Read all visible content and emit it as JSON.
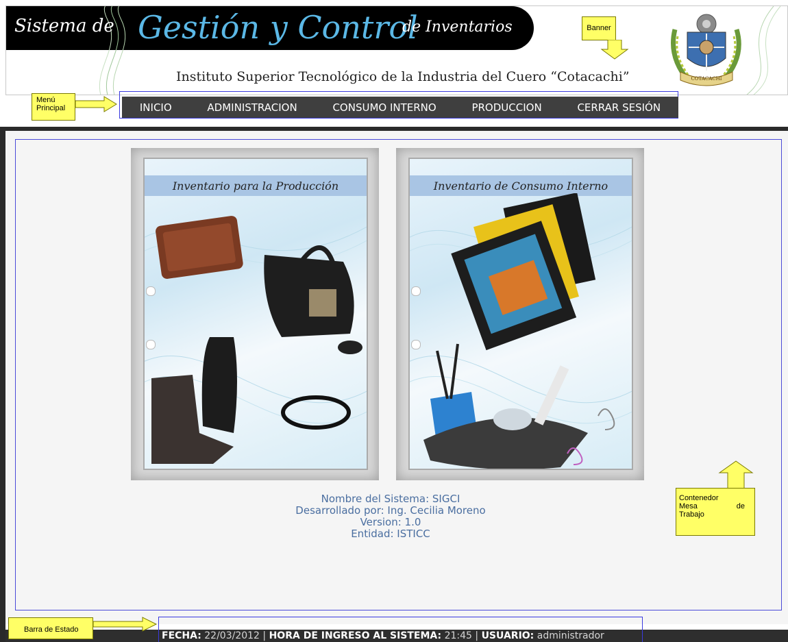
{
  "banner": {
    "title_prefix": "Sistema de",
    "title_main": "Gestión y Control",
    "title_suffix": "de Inventarios",
    "subtitle": "Instituto Superior Tecnológico de la Industria del Cuero “Cotacachi”",
    "logo_icon": "coat-of-arms-icon",
    "logo_text": "COTACACHI"
  },
  "menu": {
    "items": [
      "INICIO",
      "ADMINISTRACION",
      "CONSUMO INTERNO",
      "PRODUCCION",
      "CERRAR SESIÓN"
    ]
  },
  "cards": [
    {
      "title": "Inventario para la Producción",
      "image": "leather-products-image"
    },
    {
      "title": "Inventario de Consumo Interno",
      "image": "office-supplies-image"
    }
  ],
  "info": {
    "line1": "Nombre del Sistema: SIGCI",
    "line2": "Desarrollado por: Ing. Cecilia Moreno",
    "line3": "Version: 1.0",
    "line4": "Entidad: ISTICC"
  },
  "status": {
    "fecha_label": "FECHA:",
    "fecha_value": "22/03/2012",
    "sep": "|",
    "hora_label": "HORA DE INGRESO AL SISTEMA:",
    "hora_value": "21:45",
    "usuario_label": "USUARIO:",
    "usuario_value": "administrador"
  },
  "annotations": {
    "banner": "Banner",
    "menu_1": "Menú",
    "menu_2": "Principal",
    "workspace_1": "Contenedor",
    "workspace_2": "Mesa",
    "workspace_3": "de",
    "workspace_4": "Trabajo",
    "statusbar": "Barra de Estado"
  },
  "colors": {
    "accent_blue": "#5bb8e6",
    "frame_blue": "#3a3adf",
    "menu_bg": "#3f3f3f",
    "note_yellow": "#ffff66"
  }
}
